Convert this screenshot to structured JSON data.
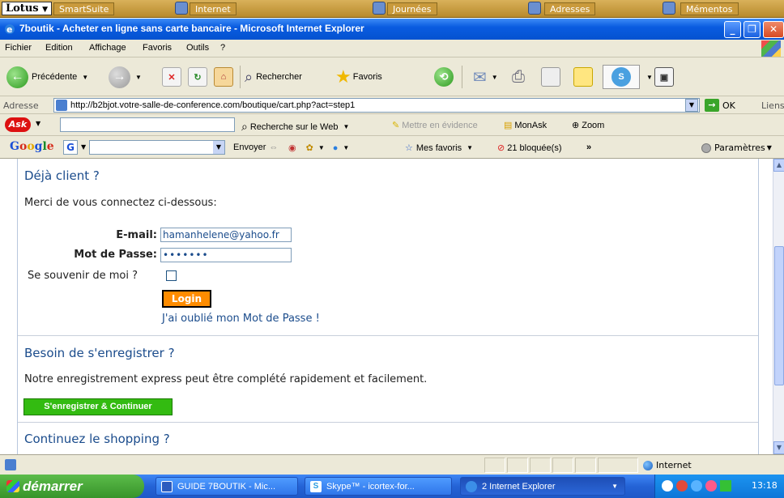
{
  "lotus_bar": {
    "logo": "Lotus",
    "items": [
      "SmartSuite",
      "Internet",
      "Journées",
      "Adresses",
      "Mémentos"
    ]
  },
  "window": {
    "title": "7boutik - Acheter en ligne sans carte bancaire - Microsoft Internet Explorer"
  },
  "menu": {
    "items": [
      "Fichier",
      "Edition",
      "Affichage",
      "Favoris",
      "Outils",
      "?"
    ]
  },
  "toolbar": {
    "back_label": "Précédente",
    "search_label": "Rechercher",
    "favorites_label": "Favoris"
  },
  "address": {
    "label": "Adresse",
    "url": "http://b2bjot.votre-salle-de-conference.com/boutique/cart.php?act=step1",
    "go_label": "OK",
    "links_label": "Liens"
  },
  "ask_toolbar": {
    "logo": "Ask",
    "search_web": "Recherche sur le Web",
    "highlight": "Mettre en évidence",
    "monask": "MonAsk",
    "zoom": "Zoom"
  },
  "google_toolbar": {
    "logo": "Google",
    "send_label": "Envoyer",
    "favorites_label": "Mes favoris",
    "blocked_label": "21 bloquée(s)",
    "more": "»",
    "settings_label": "Paramètres"
  },
  "page": {
    "existing_client": {
      "title": "Déjà client ?",
      "intro": "Merci de vous connectez ci-dessous:",
      "email_label": "E-mail:",
      "email_value": "hamanhelene@yahoo.fr",
      "password_label": "Mot de Passe:",
      "password_value": "•••••••",
      "remember_label": "Se souvenir de moi ?",
      "remember_checked": false,
      "login_label": "Login",
      "forgot_label": "J'ai oublié mon Mot de Passe !"
    },
    "register": {
      "title": "Besoin de s'enregistrer ?",
      "text": "Notre enregistrement express peut être complété rapidement et facilement.",
      "button_label": "S'enregistrer & Continuer"
    },
    "continue": {
      "title": "Continuez le shopping ?"
    }
  },
  "statusbar": {
    "zone_label": "Internet"
  },
  "taskbar": {
    "start_label": "démarrer",
    "tasks": [
      "GUIDE 7BOUTIK - Mic...",
      "Skype™ - icortex-for...",
      "2 Internet Explorer"
    ],
    "clock": "13:18"
  },
  "colors": {
    "link_blue": "#1b4c8c",
    "login_orange": "#ff8c00",
    "register_green": "#33bb11",
    "xp_blue": "#0a5ce0"
  }
}
